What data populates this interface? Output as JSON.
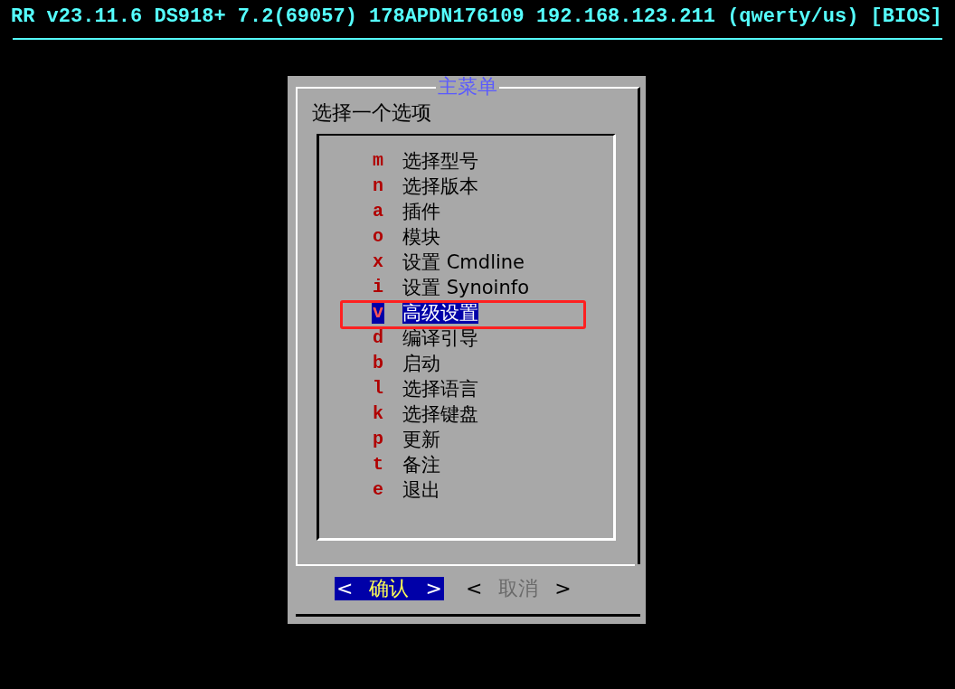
{
  "header": {
    "text": "RR v23.11.6 DS918+ 7.2(69057) 178APDN176109 192.168.123.211 (qwerty/us) [BIOS]"
  },
  "dialog": {
    "title": "主菜单",
    "prompt": "选择一个选项",
    "items": [
      {
        "key": "m",
        "label": "选择型号",
        "selected": false
      },
      {
        "key": "n",
        "label": "选择版本",
        "selected": false
      },
      {
        "key": "a",
        "label": "插件",
        "selected": false
      },
      {
        "key": "o",
        "label": "模块",
        "selected": false
      },
      {
        "key": "x",
        "label": "设置 Cmdline",
        "selected": false
      },
      {
        "key": "i",
        "label": "设置 Synoinfo",
        "selected": false
      },
      {
        "key": "v",
        "label": "高级设置",
        "selected": true
      },
      {
        "key": "d",
        "label": "编译引导",
        "selected": false
      },
      {
        "key": "b",
        "label": "启动",
        "selected": false
      },
      {
        "key": "l",
        "label": "选择语言",
        "selected": false
      },
      {
        "key": "k",
        "label": "选择键盘",
        "selected": false
      },
      {
        "key": "p",
        "label": "更新",
        "selected": false
      },
      {
        "key": "t",
        "label": "备注",
        "selected": false
      },
      {
        "key": "e",
        "label": "退出",
        "selected": false
      }
    ],
    "buttons": [
      {
        "left": "<",
        "label": "确认",
        "right": ">",
        "selected": true
      },
      {
        "left": "<",
        "label": "取消",
        "right": ">",
        "selected": false
      }
    ]
  }
}
